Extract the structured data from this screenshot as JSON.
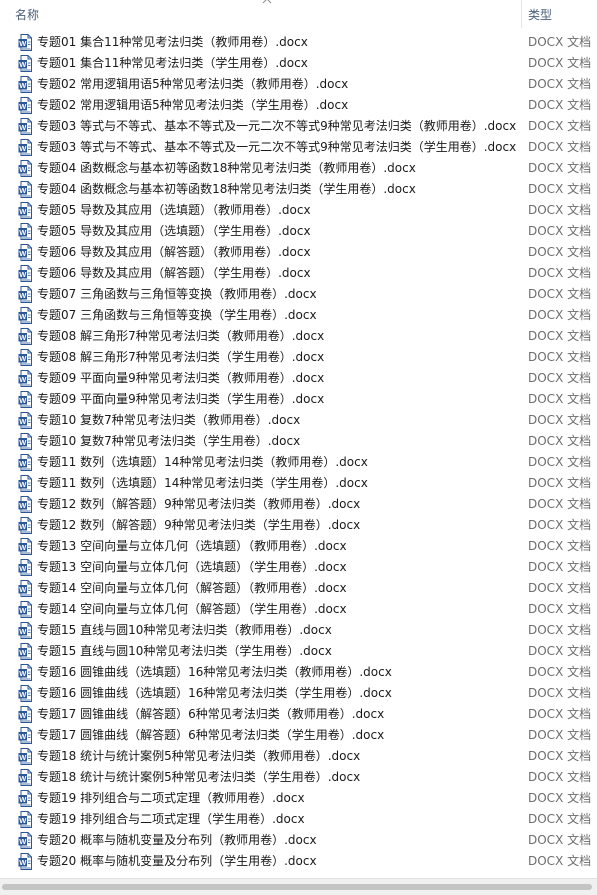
{
  "header": {
    "name_label": "名称",
    "type_label": "类型"
  },
  "files": [
    {
      "name": "专题01 集合11种常见考法归类（教师用卷）.docx",
      "type": "DOCX 文档"
    },
    {
      "name": "专题01 集合11种常见考法归类（学生用卷）.docx",
      "type": "DOCX 文档"
    },
    {
      "name": "专题02 常用逻辑用语5种常见考法归类（教师用卷）.docx",
      "type": "DOCX 文档"
    },
    {
      "name": "专题02 常用逻辑用语5种常见考法归类（学生用卷）.docx",
      "type": "DOCX 文档"
    },
    {
      "name": "专题03 等式与不等式、基本不等式及一元二次不等式9种常见考法归类（教师用卷）.docx",
      "type": "DOCX 文档"
    },
    {
      "name": "专题03 等式与不等式、基本不等式及一元二次不等式9种常见考法归类（学生用卷）.docx",
      "type": "DOCX 文档"
    },
    {
      "name": "专题04 函数概念与基本初等函数18种常见考法归类（教师用卷）.docx",
      "type": "DOCX 文档"
    },
    {
      "name": "专题04 函数概念与基本初等函数18种常见考法归类（学生用卷）.docx",
      "type": "DOCX 文档"
    },
    {
      "name": "专题05 导数及其应用（选填题）（教师用卷）.docx",
      "type": "DOCX 文档"
    },
    {
      "name": "专题05 导数及其应用（选填题）（学生用卷）.docx",
      "type": "DOCX 文档"
    },
    {
      "name": "专题06 导数及其应用（解答题）（教师用卷）.docx",
      "type": "DOCX 文档"
    },
    {
      "name": "专题06 导数及其应用（解答题）（学生用卷）.docx",
      "type": "DOCX 文档"
    },
    {
      "name": "专题07 三角函数与三角恒等变换（教师用卷）.docx",
      "type": "DOCX 文档"
    },
    {
      "name": "专题07 三角函数与三角恒等变换（学生用卷）.docx",
      "type": "DOCX 文档"
    },
    {
      "name": "专题08 解三角形7种常见考法归类（教师用卷）.docx",
      "type": "DOCX 文档"
    },
    {
      "name": "专题08 解三角形7种常见考法归类（学生用卷）.docx",
      "type": "DOCX 文档"
    },
    {
      "name": "专题09 平面向量9种常见考法归类（教师用卷）.docx",
      "type": "DOCX 文档"
    },
    {
      "name": "专题09 平面向量9种常见考法归类（学生用卷）.docx",
      "type": "DOCX 文档"
    },
    {
      "name": "专题10 复数7种常见考法归类（教师用卷）.docx",
      "type": "DOCX 文档"
    },
    {
      "name": "专题10 复数7种常见考法归类（学生用卷）.docx",
      "type": "DOCX 文档"
    },
    {
      "name": "专题11 数列（选填题）14种常见考法归类（教师用卷）.docx",
      "type": "DOCX 文档"
    },
    {
      "name": "专题11 数列（选填题）14种常见考法归类（学生用卷）.docx",
      "type": "DOCX 文档"
    },
    {
      "name": "专题12 数列（解答题）9种常见考法归类（教师用卷）.docx",
      "type": "DOCX 文档"
    },
    {
      "name": "专题12 数列（解答题）9种常见考法归类（学生用卷）.docx",
      "type": "DOCX 文档"
    },
    {
      "name": "专题13 空间向量与立体几何（选填题）（教师用卷）.docx",
      "type": "DOCX 文档"
    },
    {
      "name": "专题13 空间向量与立体几何（选填题）（学生用卷）.docx",
      "type": "DOCX 文档"
    },
    {
      "name": "专题14 空间向量与立体几何（解答题）（教师用卷）.docx",
      "type": "DOCX 文档"
    },
    {
      "name": "专题14 空间向量与立体几何（解答题）（学生用卷）.docx",
      "type": "DOCX 文档"
    },
    {
      "name": "专题15 直线与圆10种常见考法归类（教师用卷）.docx",
      "type": "DOCX 文档"
    },
    {
      "name": "专题15 直线与圆10种常见考法归类（学生用卷）.docx",
      "type": "DOCX 文档"
    },
    {
      "name": "专题16 圆锥曲线（选填题）16种常见考法归类（教师用卷）.docx",
      "type": "DOCX 文档"
    },
    {
      "name": "专题16 圆锥曲线（选填题）16种常见考法归类（学生用卷）.docx",
      "type": "DOCX 文档"
    },
    {
      "name": "专题17 圆锥曲线（解答题）6种常见考法归类（教师用卷）.docx",
      "type": "DOCX 文档"
    },
    {
      "name": "专题17 圆锥曲线（解答题）6种常见考法归类（学生用卷）.docx",
      "type": "DOCX 文档"
    },
    {
      "name": "专题18 统计与统计案例5种常见考法归类（教师用卷）.docx",
      "type": "DOCX 文档"
    },
    {
      "name": "专题18 统计与统计案例5种常见考法归类（学生用卷）.docx",
      "type": "DOCX 文档"
    },
    {
      "name": "专题19 排列组合与二项式定理（教师用卷）.docx",
      "type": "DOCX 文档"
    },
    {
      "name": "专题19 排列组合与二项式定理（学生用卷）.docx",
      "type": "DOCX 文档"
    },
    {
      "name": "专题20 概率与随机变量及分布列（教师用卷）.docx",
      "type": "DOCX 文档"
    },
    {
      "name": "专题20 概率与随机变量及分布列（学生用卷）.docx",
      "type": "DOCX 文档"
    }
  ],
  "icon": "word-docx-icon",
  "colors": {
    "icon_blue": "#2b579a",
    "header_text": "#4c607a",
    "type_text": "#6d6d6d"
  }
}
